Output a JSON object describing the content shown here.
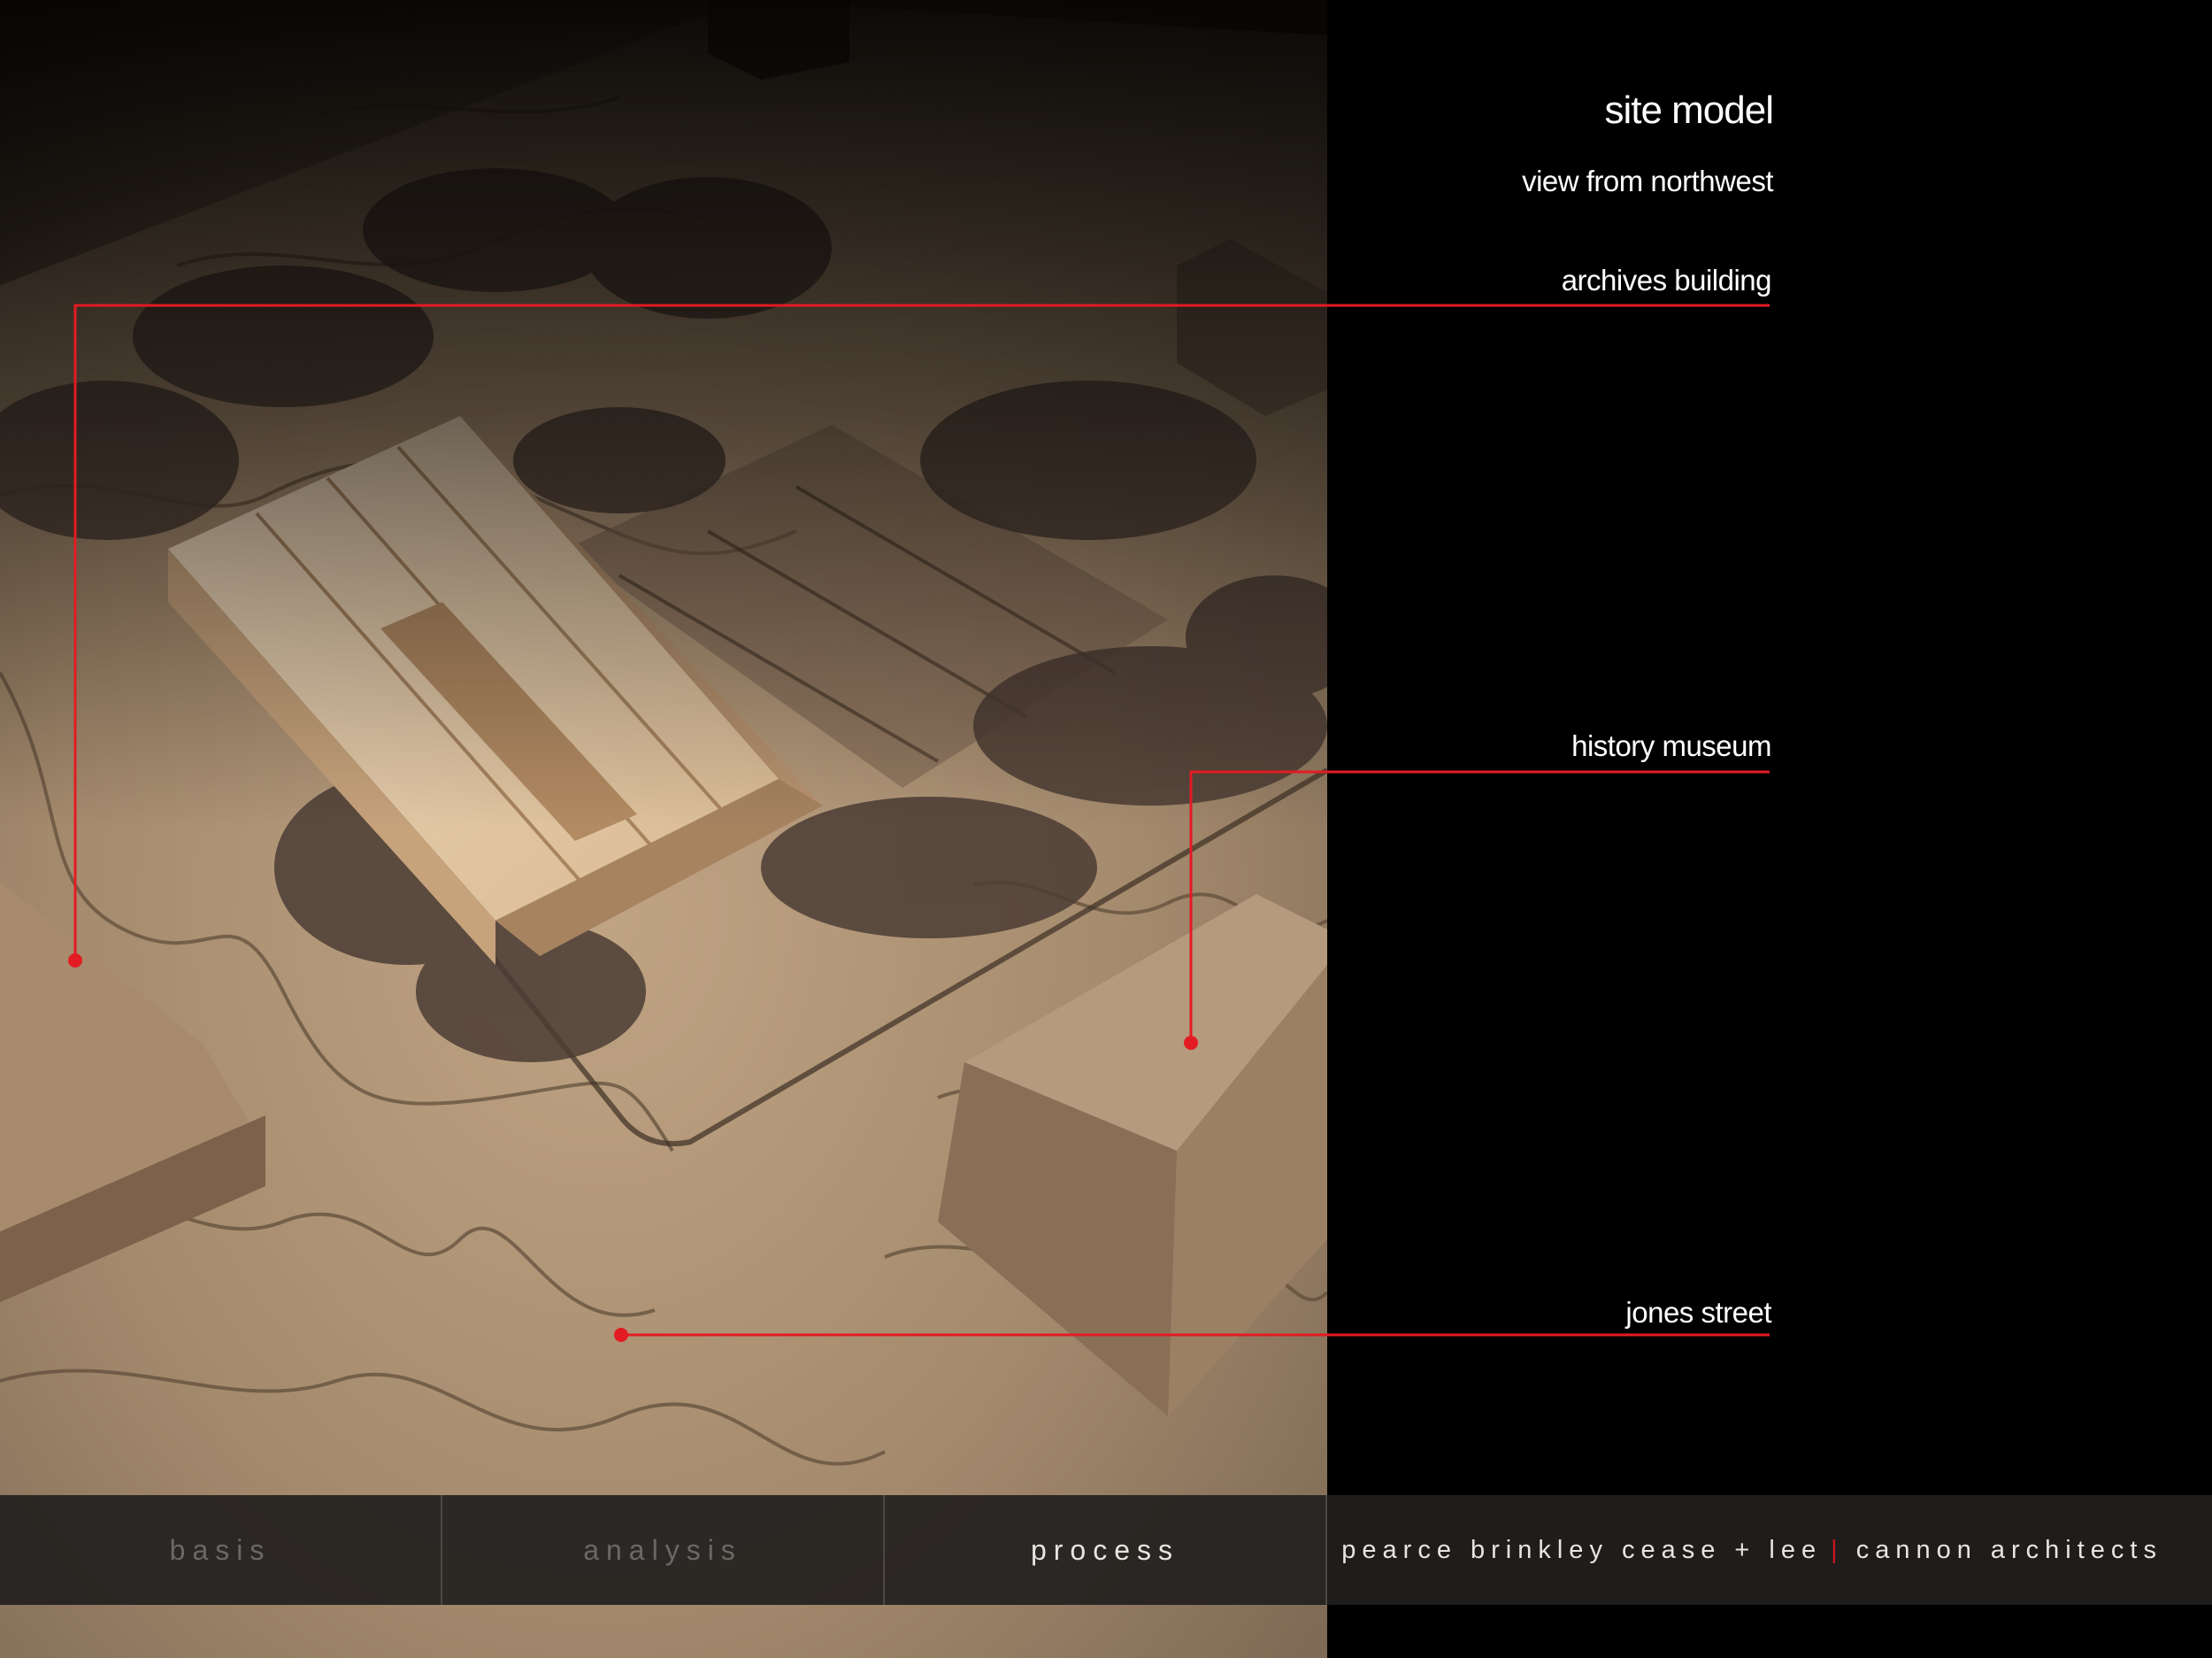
{
  "panel": {
    "title": "site model",
    "subtitle": "view from northwest"
  },
  "callouts": [
    {
      "label": "archives building"
    },
    {
      "label": "history museum"
    },
    {
      "label": "jones street"
    }
  ],
  "nav": {
    "items": [
      {
        "label": "basis",
        "active": false
      },
      {
        "label": "analysis",
        "active": false
      },
      {
        "label": "process",
        "active": true
      }
    ]
  },
  "credits": {
    "firm_1": "pearce brinkley cease + lee",
    "separator": "|",
    "firm_2": "cannon architects"
  },
  "colors": {
    "accent": "#e31b23",
    "background": "#000000",
    "nav_bar": "#22201e",
    "nav_text_inactive": "#6c6864",
    "nav_text_active": "#e8e4df"
  }
}
